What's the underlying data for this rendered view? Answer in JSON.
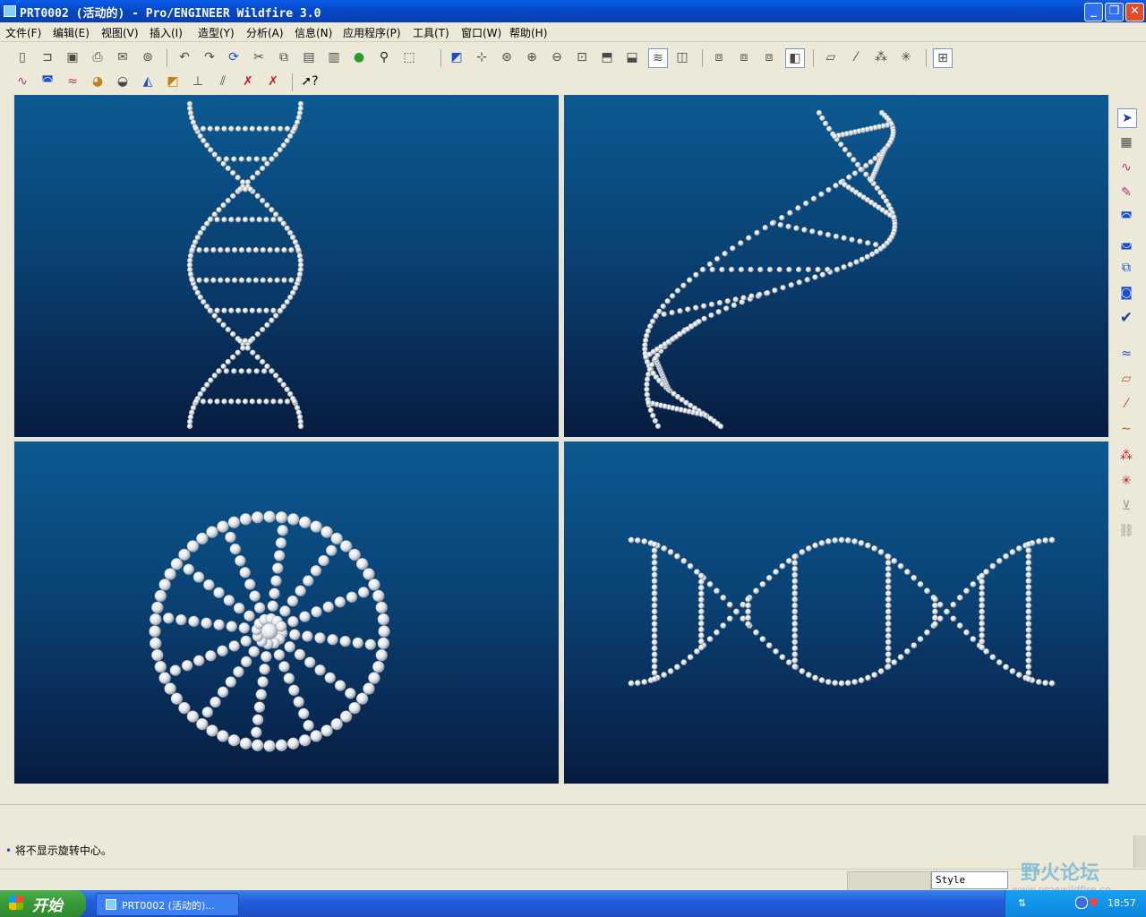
{
  "window": {
    "title": "PRT0002 (活动的) - Pro/ENGINEER Wildfire 3.0",
    "minimize": "_",
    "restore": "❐",
    "close": "✕"
  },
  "menu": [
    "文件(F)",
    "编辑(E)",
    "视图(V)",
    "插入(I)",
    "造型(Y)",
    "分析(A)",
    "信息(N)",
    "应用程序(P)",
    "工具(T)",
    "窗口(W)",
    "帮助(H)"
  ],
  "toolbar1": [
    "new",
    "open",
    "save",
    "save-copy",
    "print",
    "email",
    "send",
    "undo",
    "redo",
    "regenerate",
    "cut",
    "copy",
    "paste",
    "paste-special",
    "model-player",
    "find",
    "select-box",
    "repaint",
    "spin-center",
    "zoom-in",
    "zoom-out",
    "refit",
    "orient",
    "saved-views",
    "layers",
    "view-manager",
    "wireframe",
    "hidden-line",
    "no-hidden",
    "shading",
    "datum-planes",
    "datum-axes",
    "datum-points",
    "csys",
    "feature-tree"
  ],
  "toolbar2": [
    "curvature",
    "section",
    "reflection",
    "draft-analysis",
    "shaded-curvature",
    "slope",
    "dihedral",
    "deviation",
    "offset",
    "delete-analysis",
    "delete-all",
    "whats-this"
  ],
  "right_toolbar": [
    "select",
    "plane",
    "curve",
    "sketch-curve",
    "surface",
    "boundary",
    "trim",
    "offset-surface",
    "done",
    "cos",
    "datum-plane",
    "datum-axis",
    "datum-curve",
    "datum-point",
    "analysis-point",
    "measure",
    "chain"
  ],
  "message": {
    "bullet": "•",
    "text": "将不显示旋转中心。"
  },
  "status": {
    "filter": "Style"
  },
  "taskbar": {
    "start": "开始",
    "task": "PRT0002 (活动的)...",
    "clock": "18:57"
  },
  "watermark": {
    "text": "野火论坛",
    "url": "www.proewildfire.cn"
  },
  "colors": {
    "titlebar": "#0a5ce6",
    "viewport_top": "#0b5a92",
    "viewport_bottom": "#071c40",
    "taskbar": "#245edb"
  }
}
